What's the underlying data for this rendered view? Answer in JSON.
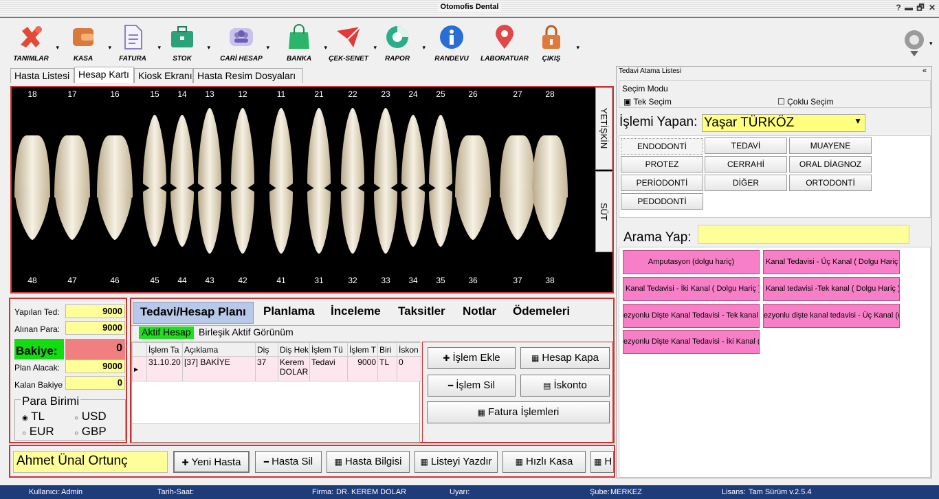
{
  "window": {
    "title": "Otomofis Dental",
    "min": "▬",
    "restore": "🗗",
    "close": "✕",
    "help": "?"
  },
  "toolbar": [
    {
      "label": "TANIMLAR",
      "icon": "tools-icon",
      "color": "#e24a35"
    },
    {
      "label": "KASA",
      "icon": "wallet-icon",
      "color": "#d9793a"
    },
    {
      "label": "FATURA",
      "icon": "document-icon",
      "color": "#8a7fc4"
    },
    {
      "label": "STOK",
      "icon": "briefcase-icon",
      "color": "#2aa37a"
    },
    {
      "label": "CARİ HESAP",
      "icon": "users-icon",
      "color": "#8b7cc9"
    },
    {
      "label": "BANKA",
      "icon": "bag-icon",
      "color": "#2ab56a"
    },
    {
      "label": "ÇEK-SENET",
      "icon": "send-icon",
      "color": "#e23a3a"
    },
    {
      "label": "RAPOR",
      "icon": "piechart-icon",
      "color": "#2aae8a"
    },
    {
      "label": "RANDEVU",
      "icon": "info-icon",
      "color": "#2a6dd4"
    },
    {
      "label": "LABORATUAR",
      "icon": "location-pin-icon",
      "color": "#e04848"
    },
    {
      "label": "ÇIKIŞ",
      "icon": "lock-icon",
      "color": "#e07a3a"
    }
  ],
  "tabs": [
    "Hasta Listesi",
    "Hesap Kartı",
    "Kiosk Ekranı",
    "Hasta Resim Dosyaları"
  ],
  "teeth": {
    "upper": [
      "18",
      "17",
      "16",
      "15",
      "14",
      "13",
      "12",
      "11",
      "21",
      "22",
      "23",
      "24",
      "25",
      "26",
      "27",
      "28"
    ],
    "lower": [
      "48",
      "47",
      "46",
      "45",
      "44",
      "43",
      "42",
      "41",
      "31",
      "32",
      "33",
      "34",
      "35",
      "36",
      "37",
      "38"
    ],
    "adult": "YETİŞKİN",
    "child": "SÜT"
  },
  "account": {
    "yapilan_label": "Yapılan Ted:",
    "yapilan": "9000",
    "alinan_label": "Alınan Para:",
    "alinan": "9000",
    "bakiye_label": "Bakiye:",
    "bakiye": "0",
    "plan_label": "Plan Alacak:",
    "plan": "9000",
    "kalan_label": "Kalan Bakiye",
    "kalan": "0",
    "currency_title": "Para Birimi",
    "currencies": [
      "TL",
      "USD",
      "EUR",
      "GBP"
    ]
  },
  "main_tabs": [
    "Tedavi/Hesap Planı",
    "Planlama",
    "İnceleme",
    "Taksitler",
    "Notlar",
    "Ödemeleri"
  ],
  "sub_tabs": [
    "Aktif Hesap",
    "Birleşik Aktif Görünüm"
  ],
  "grid": {
    "headers": [
      "İşlem Ta",
      "Açıklama",
      "Diş",
      "Diş Hek",
      "İşlem Tü",
      "İşlem T",
      "Biri",
      "İskon"
    ],
    "rows": [
      [
        "31.10.20",
        "[37] BAKİYE",
        "37",
        "Kerem DOLAR",
        "Tedavi",
        "9000",
        "TL",
        "0"
      ]
    ]
  },
  "actions": {
    "islem_ekle": "İşlem Ekle",
    "hesap_kapa": "Hesap Kapa",
    "islem_sil": "İşlem Sil",
    "iskonto": "İskonto",
    "fatura": "Fatura İşlemleri"
  },
  "bottom": {
    "patient": "Ahmet Ünal Ortunç",
    "yeni": "Yeni Hasta",
    "sil": "Hasta Sil",
    "bilgi": "Hasta Bilgisi",
    "yazdir": "Listeyi Yazdır",
    "kasa": "Hızlı Kasa",
    "more": "H"
  },
  "right": {
    "title": "Tedavi Atama Listesi",
    "collapse": "«",
    "mode_label": "Seçim Modu",
    "single": "Tek Seçim",
    "multi": "Çoklu Seçim",
    "doer_label": "İşlemi Yapan:",
    "doer": "Yaşar TÜRKÖZ",
    "categories": [
      "ENDODONTİ",
      "TEDAVİ",
      "MUAYENE",
      "PROTEZ",
      "CERRAHİ",
      "ORAL DİAGNOZ",
      "PERİODONTİ",
      "DİĞER",
      "ORTODONTİ",
      "PEDODONTİ"
    ],
    "search_label": "Arama Yap:",
    "search_value": "",
    "treatments": [
      "Amputasyon (dolgu hariç)",
      "Kanal Tedavisi - Üç Kanal ( Dolgu Hariç )",
      "Kanal Tedavisi - İki Kanal ( Dolgu Hariç )",
      "Kanal tedavisi -Tek kanal ( Dolgu Hariç )",
      "ezyonlu Dişte Kanal Tedavisi - Tek kanal ( D",
      "ezyonlu dişte kanal tedavisi - Üç Kanal      (d",
      "ezyonlu Dişte Kanal Tedavisi - İki Kanal ( D"
    ]
  },
  "status": {
    "user_label": "Kullanıcı:",
    "user": "Admin",
    "time_label": "Tarih-Saat:",
    "firm_label": "Firma:",
    "firm": "DR. KEREM DOLAR",
    "warn_label": "Uyarı:",
    "branch_label": "Şube:",
    "branch": "MERKEZ",
    "license_label": "Lisans:",
    "license": "Tam Sürüm v.2.5.4"
  }
}
